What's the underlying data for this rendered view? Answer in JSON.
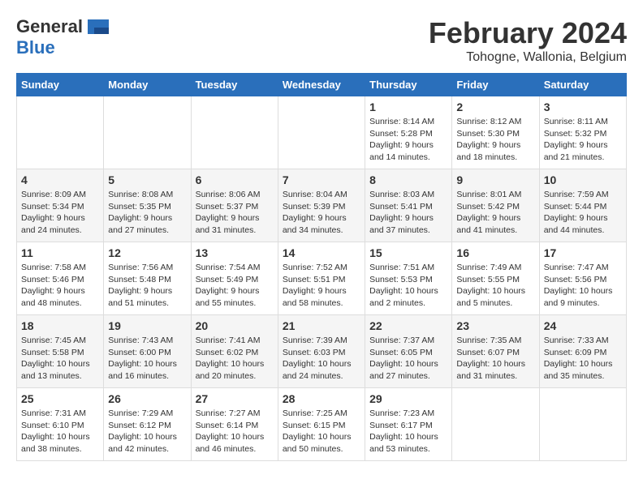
{
  "logo": {
    "general": "General",
    "blue": "Blue"
  },
  "title": "February 2024",
  "location": "Tohogne, Wallonia, Belgium",
  "headers": [
    "Sunday",
    "Monday",
    "Tuesday",
    "Wednesday",
    "Thursday",
    "Friday",
    "Saturday"
  ],
  "weeks": [
    [
      {
        "day": "",
        "info": ""
      },
      {
        "day": "",
        "info": ""
      },
      {
        "day": "",
        "info": ""
      },
      {
        "day": "",
        "info": ""
      },
      {
        "day": "1",
        "info": "Sunrise: 8:14 AM\nSunset: 5:28 PM\nDaylight: 9 hours and 14 minutes."
      },
      {
        "day": "2",
        "info": "Sunrise: 8:12 AM\nSunset: 5:30 PM\nDaylight: 9 hours and 18 minutes."
      },
      {
        "day": "3",
        "info": "Sunrise: 8:11 AM\nSunset: 5:32 PM\nDaylight: 9 hours and 21 minutes."
      }
    ],
    [
      {
        "day": "4",
        "info": "Sunrise: 8:09 AM\nSunset: 5:34 PM\nDaylight: 9 hours and 24 minutes."
      },
      {
        "day": "5",
        "info": "Sunrise: 8:08 AM\nSunset: 5:35 PM\nDaylight: 9 hours and 27 minutes."
      },
      {
        "day": "6",
        "info": "Sunrise: 8:06 AM\nSunset: 5:37 PM\nDaylight: 9 hours and 31 minutes."
      },
      {
        "day": "7",
        "info": "Sunrise: 8:04 AM\nSunset: 5:39 PM\nDaylight: 9 hours and 34 minutes."
      },
      {
        "day": "8",
        "info": "Sunrise: 8:03 AM\nSunset: 5:41 PM\nDaylight: 9 hours and 37 minutes."
      },
      {
        "day": "9",
        "info": "Sunrise: 8:01 AM\nSunset: 5:42 PM\nDaylight: 9 hours and 41 minutes."
      },
      {
        "day": "10",
        "info": "Sunrise: 7:59 AM\nSunset: 5:44 PM\nDaylight: 9 hours and 44 minutes."
      }
    ],
    [
      {
        "day": "11",
        "info": "Sunrise: 7:58 AM\nSunset: 5:46 PM\nDaylight: 9 hours and 48 minutes."
      },
      {
        "day": "12",
        "info": "Sunrise: 7:56 AM\nSunset: 5:48 PM\nDaylight: 9 hours and 51 minutes."
      },
      {
        "day": "13",
        "info": "Sunrise: 7:54 AM\nSunset: 5:49 PM\nDaylight: 9 hours and 55 minutes."
      },
      {
        "day": "14",
        "info": "Sunrise: 7:52 AM\nSunset: 5:51 PM\nDaylight: 9 hours and 58 minutes."
      },
      {
        "day": "15",
        "info": "Sunrise: 7:51 AM\nSunset: 5:53 PM\nDaylight: 10 hours and 2 minutes."
      },
      {
        "day": "16",
        "info": "Sunrise: 7:49 AM\nSunset: 5:55 PM\nDaylight: 10 hours and 5 minutes."
      },
      {
        "day": "17",
        "info": "Sunrise: 7:47 AM\nSunset: 5:56 PM\nDaylight: 10 hours and 9 minutes."
      }
    ],
    [
      {
        "day": "18",
        "info": "Sunrise: 7:45 AM\nSunset: 5:58 PM\nDaylight: 10 hours and 13 minutes."
      },
      {
        "day": "19",
        "info": "Sunrise: 7:43 AM\nSunset: 6:00 PM\nDaylight: 10 hours and 16 minutes."
      },
      {
        "day": "20",
        "info": "Sunrise: 7:41 AM\nSunset: 6:02 PM\nDaylight: 10 hours and 20 minutes."
      },
      {
        "day": "21",
        "info": "Sunrise: 7:39 AM\nSunset: 6:03 PM\nDaylight: 10 hours and 24 minutes."
      },
      {
        "day": "22",
        "info": "Sunrise: 7:37 AM\nSunset: 6:05 PM\nDaylight: 10 hours and 27 minutes."
      },
      {
        "day": "23",
        "info": "Sunrise: 7:35 AM\nSunset: 6:07 PM\nDaylight: 10 hours and 31 minutes."
      },
      {
        "day": "24",
        "info": "Sunrise: 7:33 AM\nSunset: 6:09 PM\nDaylight: 10 hours and 35 minutes."
      }
    ],
    [
      {
        "day": "25",
        "info": "Sunrise: 7:31 AM\nSunset: 6:10 PM\nDaylight: 10 hours and 38 minutes."
      },
      {
        "day": "26",
        "info": "Sunrise: 7:29 AM\nSunset: 6:12 PM\nDaylight: 10 hours and 42 minutes."
      },
      {
        "day": "27",
        "info": "Sunrise: 7:27 AM\nSunset: 6:14 PM\nDaylight: 10 hours and 46 minutes."
      },
      {
        "day": "28",
        "info": "Sunrise: 7:25 AM\nSunset: 6:15 PM\nDaylight: 10 hours and 50 minutes."
      },
      {
        "day": "29",
        "info": "Sunrise: 7:23 AM\nSunset: 6:17 PM\nDaylight: 10 hours and 53 minutes."
      },
      {
        "day": "",
        "info": ""
      },
      {
        "day": "",
        "info": ""
      }
    ]
  ]
}
